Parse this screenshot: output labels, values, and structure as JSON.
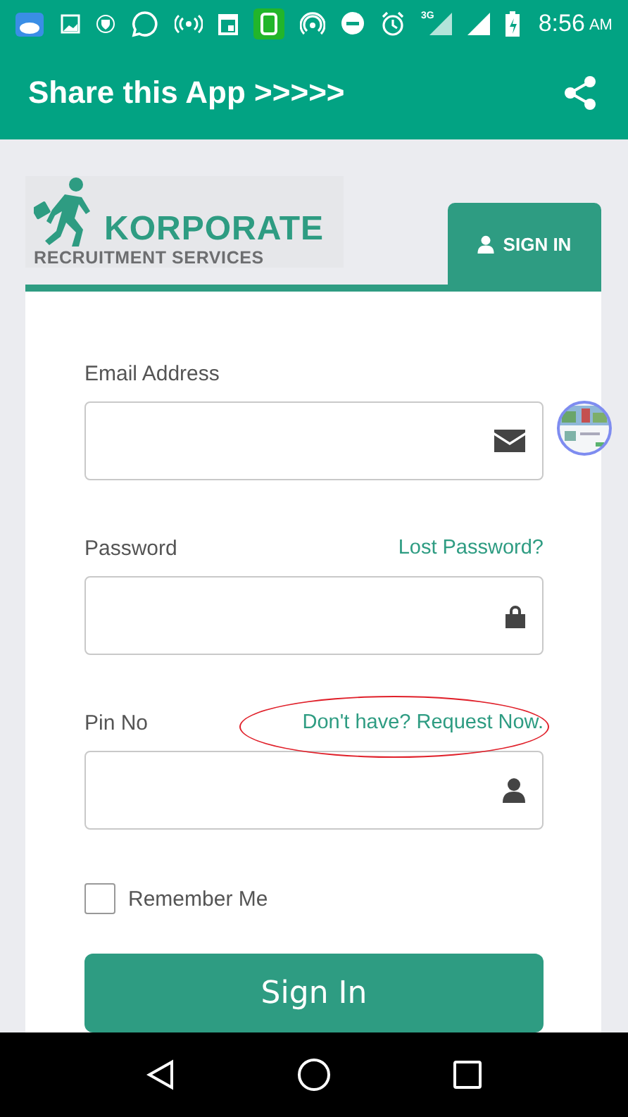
{
  "status_bar": {
    "network": "3G",
    "time": "8:56",
    "ampm": "AM"
  },
  "app_bar": {
    "title": "Share this App >>>>>"
  },
  "logo": {
    "brand": "KORPORATE",
    "tagline": "RECRUITMENT SERVICES"
  },
  "tabs": [
    {
      "label": "SIGN IN",
      "selected": true
    }
  ],
  "fields": [
    {
      "label": "Email Address",
      "kind": "email"
    },
    {
      "label": "Password",
      "kind": "password",
      "link": "Lost Password?",
      "circled": false
    },
    {
      "label": "Pin No",
      "kind": "pin",
      "link": "Don't have? Request Now.",
      "circled": true
    }
  ],
  "remember": {
    "label": "Remember Me",
    "checked": false
  },
  "submit": {
    "label": "Sign In"
  }
}
